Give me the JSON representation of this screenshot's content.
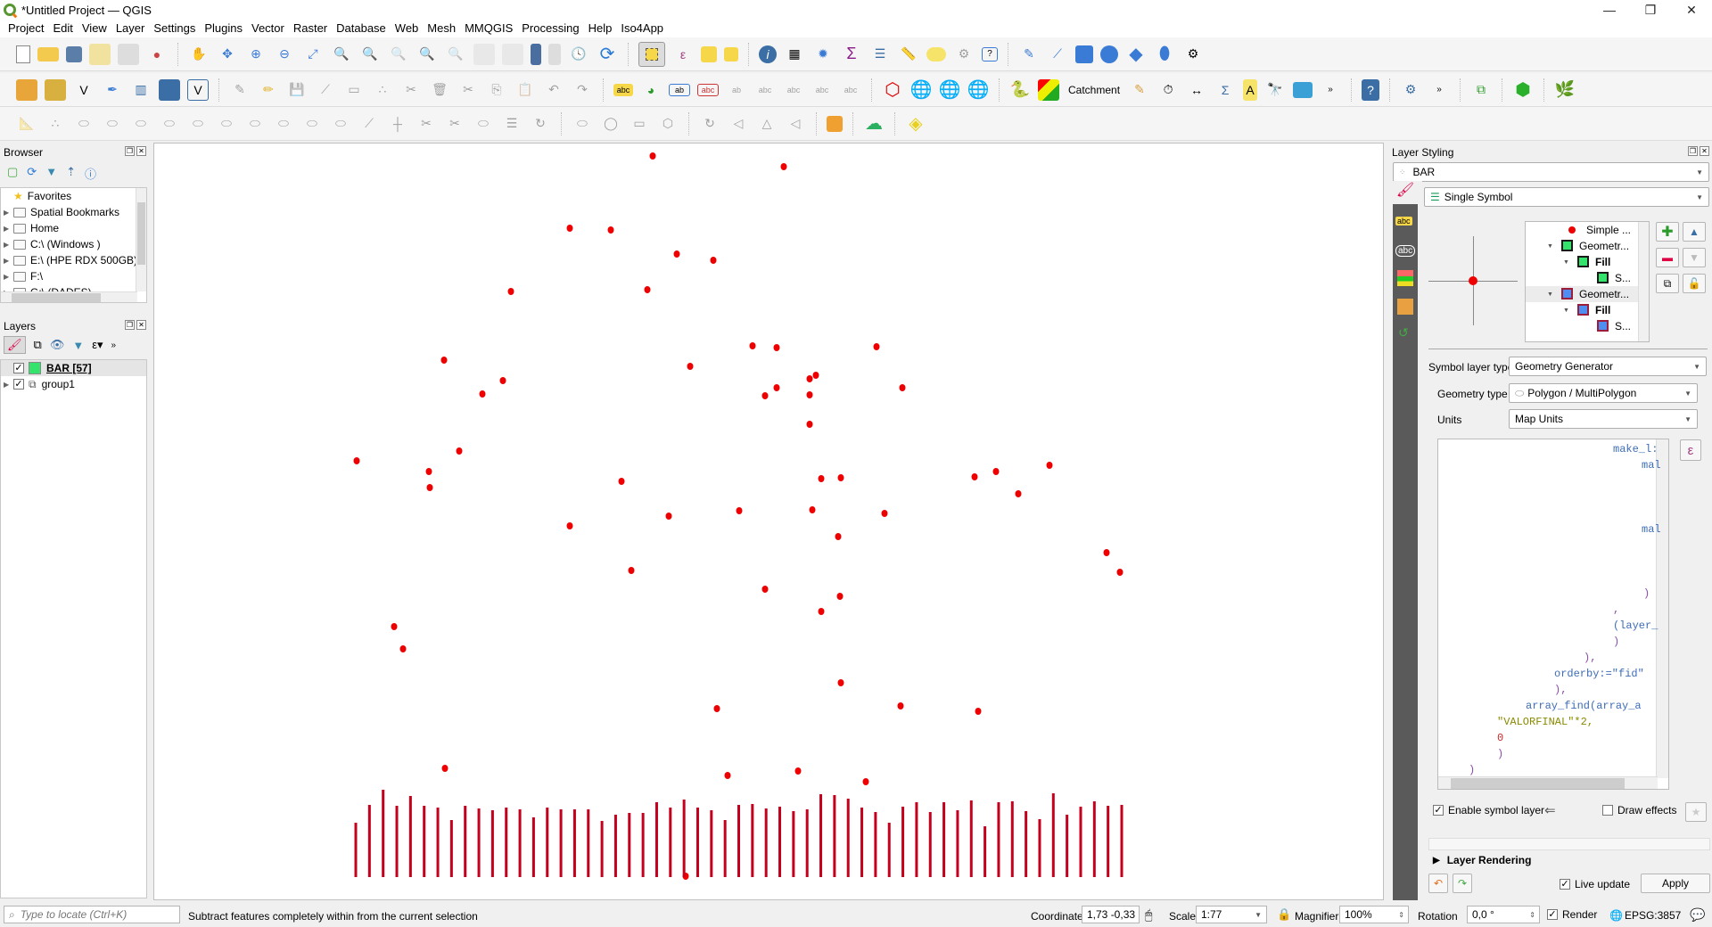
{
  "window": {
    "title": "*Untitled Project — QGIS",
    "controls": [
      "—",
      "❐",
      "✕"
    ]
  },
  "menu": [
    "Project",
    "Edit",
    "View",
    "Layer",
    "Settings",
    "Plugins",
    "Vector",
    "Raster",
    "Database",
    "Web",
    "Mesh",
    "MMQGIS",
    "Processing",
    "Help",
    "Iso4App"
  ],
  "toolbar2": {
    "catchment_label": "Catchment"
  },
  "browser": {
    "title": "Browser",
    "items": [
      {
        "label": "Favorites",
        "icon": "star-icon"
      },
      {
        "label": "Spatial Bookmarks",
        "icon": "bookmark-icon"
      },
      {
        "label": "Home",
        "icon": "home-folder-icon"
      },
      {
        "label": "C:\\ (Windows )",
        "icon": "folder-icon"
      },
      {
        "label": "E:\\ (HPE RDX 500GB)",
        "icon": "folder-icon"
      },
      {
        "label": "F:\\",
        "icon": "folder-icon"
      },
      {
        "label": "G:\\ (DADES)",
        "icon": "folder-icon"
      }
    ]
  },
  "layers": {
    "title": "Layers",
    "items": [
      {
        "label": "BAR [57]",
        "checked": true,
        "color": "#33e36b"
      },
      {
        "label": "group1",
        "checked": true
      }
    ]
  },
  "map": {
    "point_color": "#ee0000",
    "bar_color": "#c4001d",
    "points": [
      [
        731,
        174
      ],
      [
        878,
        186
      ],
      [
        638,
        255
      ],
      [
        684,
        257
      ],
      [
        758,
        284
      ],
      [
        799,
        291
      ],
      [
        572,
        326
      ],
      [
        725,
        324
      ],
      [
        497,
        403
      ],
      [
        773,
        410
      ],
      [
        563,
        426
      ],
      [
        843,
        387
      ],
      [
        870,
        389
      ],
      [
        982,
        388
      ],
      [
        540,
        441
      ],
      [
        857,
        443
      ],
      [
        870,
        434
      ],
      [
        907,
        424
      ],
      [
        914,
        420
      ],
      [
        907,
        442
      ],
      [
        1011,
        434
      ],
      [
        907,
        475
      ],
      [
        399,
        516
      ],
      [
        514,
        505
      ],
      [
        1116,
        528
      ],
      [
        1176,
        521
      ],
      [
        1092,
        534
      ],
      [
        480,
        528
      ],
      [
        481,
        546
      ],
      [
        696,
        539
      ],
      [
        1141,
        553
      ],
      [
        920,
        536
      ],
      [
        942,
        535
      ],
      [
        828,
        572
      ],
      [
        910,
        571
      ],
      [
        991,
        575
      ],
      [
        749,
        578
      ],
      [
        638,
        589
      ],
      [
        939,
        601
      ],
      [
        707,
        639
      ],
      [
        857,
        660
      ],
      [
        920,
        685
      ],
      [
        941,
        668
      ],
      [
        441,
        702
      ],
      [
        451,
        727
      ],
      [
        1240,
        619
      ],
      [
        1255,
        641
      ],
      [
        942,
        765
      ],
      [
        803,
        794
      ],
      [
        1009,
        791
      ],
      [
        1096,
        797
      ],
      [
        498,
        861
      ],
      [
        815,
        869
      ],
      [
        894,
        864
      ],
      [
        970,
        876
      ],
      [
        768,
        982
      ]
    ],
    "bars": [
      61,
      81,
      98,
      80,
      91,
      80,
      78,
      64,
      80,
      77,
      75,
      78,
      76,
      67,
      78,
      76,
      76,
      76,
      63,
      70,
      72,
      72,
      84,
      78,
      87,
      78,
      75,
      64,
      81,
      82,
      77,
      79,
      74,
      76,
      93,
      92,
      88,
      78,
      73,
      61,
      79,
      84,
      73,
      84,
      75,
      86,
      57,
      84,
      85,
      74,
      65,
      94,
      70,
      79,
      85,
      80,
      81
    ]
  },
  "styling": {
    "title": "Layer Styling",
    "layer_select": "BAR",
    "renderer": "Single Symbol",
    "symbol_tree": [
      {
        "label": "Simple ...",
        "depth": 0,
        "swatch": "dot",
        "color": "#ee0000"
      },
      {
        "label": "Geometr...",
        "depth": 0,
        "swatch": "square",
        "color": "#33e36b",
        "border": "#1a1a1a"
      },
      {
        "label": "Fill",
        "depth": 1,
        "swatch": "square",
        "color": "#33e36b",
        "border": "#1a1a1a",
        "bold": true
      },
      {
        "label": "S...",
        "depth": 2,
        "swatch": "square",
        "color": "#33e36b",
        "border": "#1a1a1a"
      },
      {
        "label": "Geometr...",
        "depth": 0,
        "swatch": "square",
        "color": "#4f8ef0",
        "border": "#9c1c3c",
        "selected": true
      },
      {
        "label": "Fill",
        "depth": 1,
        "swatch": "square",
        "color": "#4f8ef0",
        "border": "#9c1c3c",
        "bold": true
      },
      {
        "label": "S...",
        "depth": 2,
        "swatch": "square",
        "color": "#4f8ef0",
        "border": "#9c1c3c"
      }
    ],
    "symbol_layer_type_label": "Symbol layer type",
    "symbol_layer_type": "Geometry Generator",
    "geometry_type_label": "Geometry type",
    "geometry_type": "Polygon / MultiPolygon",
    "units_label": "Units",
    "units": "Map Units",
    "expression_lines": [
      {
        "text": "make_l:",
        "indent": 196,
        "color": "#3d6cb5"
      },
      {
        "text": "mal",
        "indent": 228,
        "color": "#3d6cb5"
      },
      {
        "text": "",
        "indent": 0,
        "color": "#000"
      },
      {
        "text": "",
        "indent": 0,
        "color": "#000"
      },
      {
        "text": "",
        "indent": 0,
        "color": "#000"
      },
      {
        "text": "mal",
        "indent": 228,
        "color": "#3d6cb5"
      },
      {
        "text": "",
        "indent": 0,
        "color": "#000"
      },
      {
        "text": "",
        "indent": 0,
        "color": "#000"
      },
      {
        "text": "",
        "indent": 0,
        "color": "#000"
      },
      {
        "text": ")",
        "indent": 230,
        "color": "#8a4fa8"
      },
      {
        "text": ",",
        "indent": 196,
        "color": "#8a4fa8"
      },
      {
        "text": "(layer_",
        "indent": 196,
        "color": "#3d6cb5"
      },
      {
        "text": ")",
        "indent": 196,
        "color": "#8a4fa8"
      },
      {
        "text": "),",
        "indent": 163,
        "color": "#8a4fa8"
      },
      {
        "text": "orderby:=\"fid\"",
        "indent": 130,
        "color": "#3d6cb5"
      },
      {
        "text": "),",
        "indent": 130,
        "color": "#8a4fa8"
      },
      {
        "text": "array_find(array_a",
        "indent": 98,
        "color": "#3d6cb5"
      },
      {
        "text": "\"VALORFINAL\"*2,",
        "indent": 66,
        "color": "#8a8a00"
      },
      {
        "text": "0",
        "indent": 66,
        "color": "#c62828"
      },
      {
        "text": ")",
        "indent": 66,
        "color": "#8a4fa8"
      },
      {
        "text": ")",
        "indent": 34,
        "color": "#8a4fa8"
      }
    ],
    "enable_symbol_layer_label": "Enable symbol layer",
    "enable_symbol_layer": true,
    "draw_effects_label": "Draw effects",
    "draw_effects": false,
    "layer_rendering_label": "Layer Rendering",
    "live_update_label": "Live update",
    "live_update": true,
    "apply_label": "Apply"
  },
  "status": {
    "locate_placeholder": "Type to locate (Ctrl+K)",
    "message": "Subtract features completely within from the current selection",
    "coordinate_label": "Coordinate",
    "coordinate": "1,73 -0,33",
    "scale_label": "Scale",
    "scale": "1:77",
    "magnifier_label": "Magnifier",
    "magnifier": "100%",
    "rotation_label": "Rotation",
    "rotation": "0,0 °",
    "render_label": "Render",
    "render": true,
    "crs": "EPSG:3857"
  }
}
